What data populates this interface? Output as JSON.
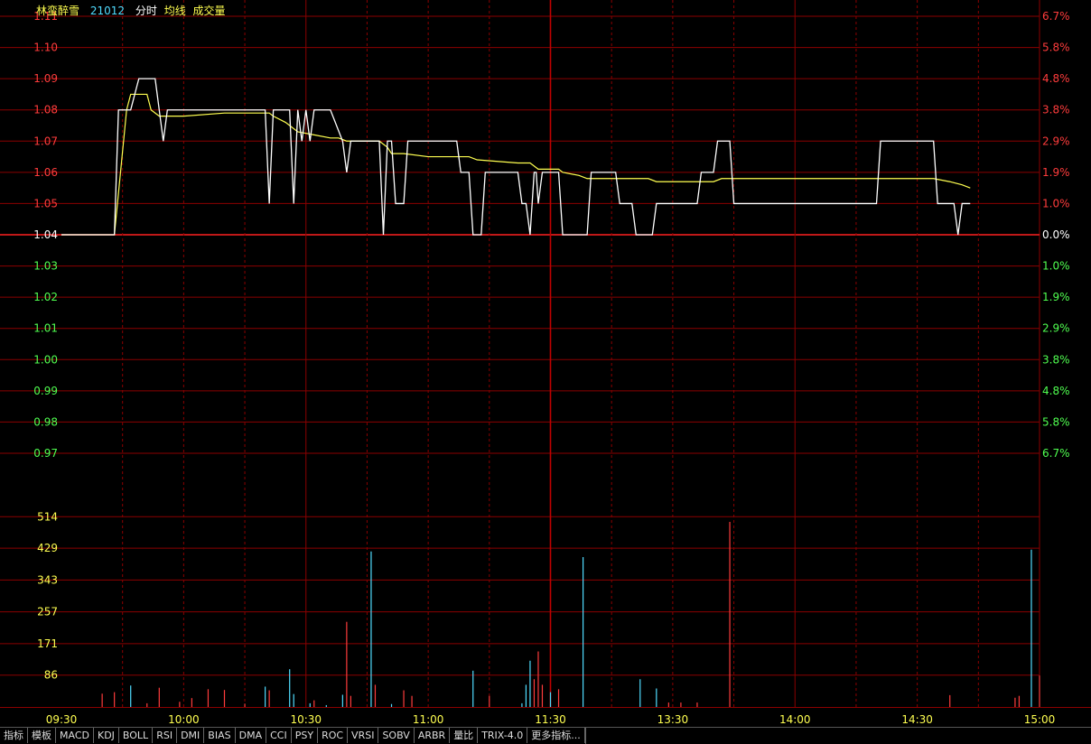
{
  "header": {
    "stock_name": "林蛮醉雪",
    "stock_code": "21012",
    "chart_mode": "分时",
    "avg_label": "均线",
    "vol_label": "成交量"
  },
  "colors": {
    "background": "#000000",
    "grid": "#8b0000",
    "up": "#ff3c3c",
    "down": "#50ff50",
    "price_line": "#ffffff",
    "avg_line": "#ffff50",
    "vol_up": "#ff3c3c",
    "vol_down": "#50dcff",
    "axis_text": "#ffff50"
  },
  "tabs": [
    "指标",
    "模板",
    "MACD",
    "KDJ",
    "BOLL",
    "RSI",
    "DMI",
    "BIAS",
    "DMA",
    "CCI",
    "PSY",
    "ROC",
    "VRSI",
    "SOBV",
    "ARBR",
    "量比",
    "TRIX-4.0",
    "更多指标..."
  ],
  "chart_data": {
    "type": "line",
    "title": "",
    "prev_close": 1.04,
    "price_ticks": [
      "1.11",
      "1.10",
      "1.09",
      "1.08",
      "1.07",
      "1.06",
      "1.05",
      "1.04",
      "1.03",
      "1.02",
      "1.01",
      "1.00",
      "0.99",
      "0.98",
      "0.97"
    ],
    "pct_ticks": [
      "6.7%",
      "5.8%",
      "4.8%",
      "3.8%",
      "2.9%",
      "1.9%",
      "1.0%",
      "0.0%",
      "1.0%",
      "1.9%",
      "2.9%",
      "3.8%",
      "4.8%",
      "5.8%",
      "6.7%"
    ],
    "ylim": [
      0.97,
      1.11
    ],
    "volume_ticks": [
      "514",
      "429",
      "343",
      "257",
      "171",
      "86"
    ],
    "volume_ylim": [
      0,
      600
    ],
    "time_labels": [
      "09:30",
      "10:00",
      "10:30",
      "11:00",
      "11:30",
      "13:30",
      "14:00",
      "14:30",
      "15:00"
    ],
    "x_unit": "trading minute (0 = 09:30, 120 = 11:30/13:00, 240 = 15:00)",
    "price": [
      [
        0,
        1.04
      ],
      [
        13,
        1.04
      ],
      [
        14,
        1.08
      ],
      [
        17,
        1.08
      ],
      [
        19,
        1.09
      ],
      [
        23,
        1.09
      ],
      [
        25,
        1.07
      ],
      [
        26,
        1.08
      ],
      [
        50,
        1.08
      ],
      [
        51,
        1.05
      ],
      [
        52,
        1.08
      ],
      [
        56,
        1.08
      ],
      [
        57,
        1.05
      ],
      [
        58,
        1.08
      ],
      [
        59,
        1.07
      ],
      [
        60,
        1.08
      ],
      [
        61,
        1.07
      ],
      [
        62,
        1.08
      ],
      [
        66,
        1.08
      ],
      [
        69,
        1.07
      ],
      [
        70,
        1.06
      ],
      [
        71,
        1.07
      ],
      [
        78,
        1.07
      ],
      [
        79,
        1.04
      ],
      [
        80,
        1.07
      ],
      [
        81,
        1.07
      ],
      [
        82,
        1.05
      ],
      [
        84,
        1.05
      ],
      [
        85,
        1.07
      ],
      [
        97,
        1.07
      ],
      [
        98,
        1.06
      ],
      [
        100,
        1.06
      ],
      [
        101,
        1.04
      ],
      [
        103,
        1.04
      ],
      [
        104,
        1.06
      ],
      [
        112,
        1.06
      ],
      [
        113,
        1.05
      ],
      [
        114,
        1.05
      ],
      [
        115,
        1.04
      ],
      [
        116,
        1.06
      ],
      [
        116.5,
        1.06
      ],
      [
        117,
        1.05
      ],
      [
        118,
        1.06
      ],
      [
        122,
        1.06
      ],
      [
        123,
        1.04
      ],
      [
        129,
        1.04
      ],
      [
        130,
        1.06
      ],
      [
        136,
        1.06
      ],
      [
        137,
        1.05
      ],
      [
        140,
        1.05
      ],
      [
        141,
        1.04
      ],
      [
        145,
        1.04
      ],
      [
        146,
        1.05
      ],
      [
        156,
        1.05
      ],
      [
        157,
        1.06
      ],
      [
        160,
        1.06
      ],
      [
        161,
        1.07
      ],
      [
        164,
        1.07
      ],
      [
        165,
        1.05
      ],
      [
        200,
        1.05
      ],
      [
        201,
        1.07
      ],
      [
        214,
        1.07
      ],
      [
        215,
        1.05
      ],
      [
        219,
        1.05
      ],
      [
        220,
        1.04
      ],
      [
        221,
        1.05
      ],
      [
        223,
        1.05
      ]
    ],
    "average": [
      [
        0,
        1.04
      ],
      [
        13,
        1.04
      ],
      [
        16,
        1.08
      ],
      [
        17,
        1.085
      ],
      [
        19,
        1.085
      ],
      [
        21,
        1.085
      ],
      [
        22,
        1.08
      ],
      [
        24,
        1.078
      ],
      [
        26,
        1.078
      ],
      [
        30,
        1.078
      ],
      [
        40,
        1.079
      ],
      [
        51,
        1.079
      ],
      [
        52,
        1.078
      ],
      [
        55,
        1.076
      ],
      [
        58,
        1.073
      ],
      [
        62,
        1.072
      ],
      [
        66,
        1.071
      ],
      [
        68,
        1.071
      ],
      [
        70,
        1.07
      ],
      [
        78,
        1.07
      ],
      [
        80,
        1.068
      ],
      [
        81,
        1.066
      ],
      [
        84,
        1.066
      ],
      [
        90,
        1.065
      ],
      [
        100,
        1.065
      ],
      [
        102,
        1.064
      ],
      [
        112,
        1.063
      ],
      [
        115,
        1.063
      ],
      [
        117,
        1.061
      ],
      [
        122,
        1.061
      ],
      [
        123,
        1.06
      ],
      [
        127,
        1.059
      ],
      [
        129,
        1.058
      ],
      [
        135,
        1.058
      ],
      [
        140,
        1.058
      ],
      [
        144,
        1.058
      ],
      [
        146,
        1.057
      ],
      [
        156,
        1.057
      ],
      [
        160,
        1.057
      ],
      [
        162,
        1.058
      ],
      [
        200,
        1.058
      ],
      [
        214,
        1.058
      ],
      [
        218,
        1.057
      ],
      [
        221,
        1.056
      ],
      [
        223,
        1.055
      ]
    ],
    "volume": [
      [
        10,
        36,
        "up"
      ],
      [
        13,
        40,
        "up"
      ],
      [
        17,
        58,
        "down"
      ],
      [
        21,
        10,
        "up"
      ],
      [
        24,
        52,
        "up"
      ],
      [
        29,
        14,
        "up"
      ],
      [
        32,
        24,
        "up"
      ],
      [
        36,
        48,
        "up"
      ],
      [
        40,
        46,
        "up"
      ],
      [
        45,
        9,
        "up"
      ],
      [
        50,
        55,
        "down"
      ],
      [
        51,
        45,
        "up"
      ],
      [
        56,
        102,
        "down"
      ],
      [
        57,
        35,
        "down"
      ],
      [
        61,
        10,
        "down"
      ],
      [
        62,
        18,
        "up"
      ],
      [
        65,
        5,
        "down"
      ],
      [
        69,
        33,
        "down"
      ],
      [
        70,
        230,
        "up"
      ],
      [
        71,
        30,
        "up"
      ],
      [
        76,
        420,
        "down"
      ],
      [
        77,
        60,
        "up"
      ],
      [
        81,
        8,
        "down"
      ],
      [
        84,
        45,
        "up"
      ],
      [
        86,
        30,
        "up"
      ],
      [
        101,
        98,
        "down"
      ],
      [
        105,
        30,
        "up"
      ],
      [
        113,
        10,
        "down"
      ],
      [
        114,
        60,
        "down"
      ],
      [
        115,
        125,
        "down"
      ],
      [
        116,
        75,
        "up"
      ],
      [
        117,
        150,
        "up"
      ],
      [
        118,
        60,
        "up"
      ],
      [
        120,
        40,
        "down"
      ],
      [
        122,
        48,
        "up"
      ],
      [
        128,
        405,
        "down"
      ],
      [
        142,
        75,
        "down"
      ],
      [
        146,
        50,
        "down"
      ],
      [
        149,
        12,
        "up"
      ],
      [
        152,
        12,
        "up"
      ],
      [
        156,
        12,
        "up"
      ],
      [
        164,
        500,
        "up"
      ],
      [
        218,
        32,
        "up"
      ],
      [
        234,
        25,
        "up"
      ],
      [
        235,
        30,
        "up"
      ],
      [
        238,
        425,
        "down"
      ],
      [
        240,
        85,
        "up"
      ]
    ]
  }
}
